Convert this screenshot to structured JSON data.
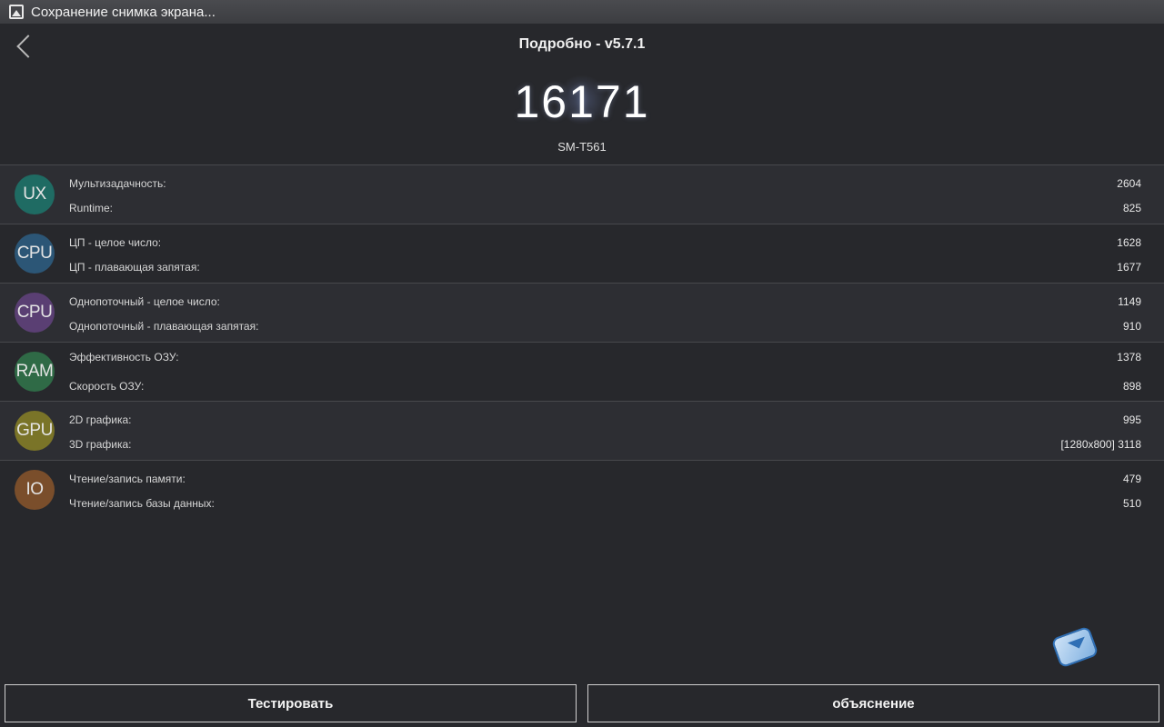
{
  "status": {
    "text": "Сохранение снимка экрана..."
  },
  "header": {
    "title": "Подробно - v5.7.1"
  },
  "result": {
    "score": "16171",
    "device": "SM-T561"
  },
  "categories": [
    {
      "badge": "UX",
      "color": "#1f6b63",
      "items": [
        {
          "label": "Мультизадачность:",
          "value": "2604"
        },
        {
          "label": "Runtime:",
          "value": "825"
        }
      ]
    },
    {
      "badge": "CPU",
      "color": "#2c5676",
      "items": [
        {
          "label": "ЦП - целое число:",
          "value": "1628"
        },
        {
          "label": "ЦП - плавающая запятая:",
          "value": "1677"
        }
      ]
    },
    {
      "badge": "CPU",
      "color": "#5a3f73",
      "items": [
        {
          "label": "Однопоточный - целое число:",
          "value": "1149"
        },
        {
          "label": "Однопоточный - плавающая запятая:",
          "value": "910"
        }
      ]
    },
    {
      "badge": "RAM",
      "color": "#2f6a46",
      "items": [
        {
          "label": "Эффективность ОЗУ:",
          "value": "1378"
        },
        {
          "label": "Скорость ОЗУ:",
          "value": "898"
        }
      ]
    },
    {
      "badge": "GPU",
      "color": "#7a7428",
      "items": [
        {
          "label": "2D графика:",
          "value": "995"
        },
        {
          "label": "3D графика:",
          "value": "[1280x800] 3118"
        }
      ]
    },
    {
      "badge": "IO",
      "color": "#7a4e2b",
      "items": [
        {
          "label": "Чтение/запись памяти:",
          "value": "479"
        },
        {
          "label": "Чтение/запись базы данных:",
          "value": "510"
        }
      ]
    }
  ],
  "buttons": {
    "test": "Тестировать",
    "explain": "объяснение"
  }
}
